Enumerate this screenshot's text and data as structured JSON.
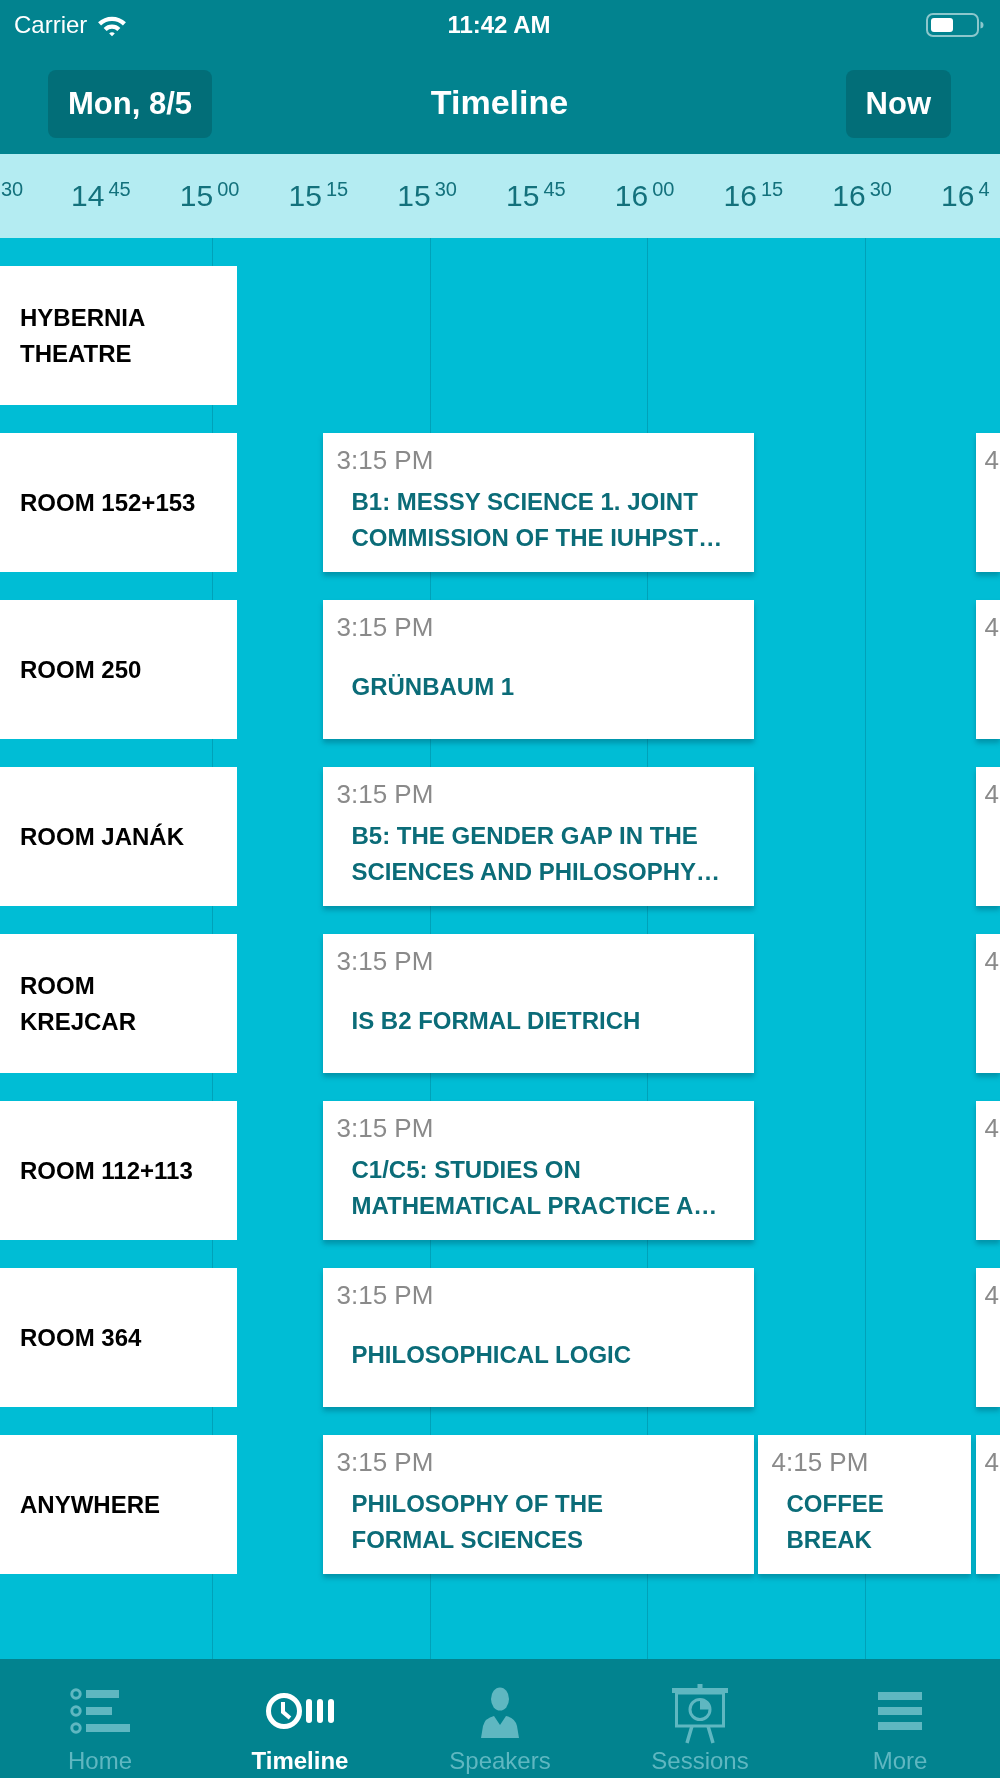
{
  "status_bar": {
    "carrier": "Carrier",
    "time": "11:42 AM"
  },
  "header": {
    "date_button": "Mon, 8/5",
    "title": "Timeline",
    "now_button": "Now"
  },
  "ruler": {
    "ticks": [
      "$^{30}$",
      "14$^{45}$",
      "15$^{00}$",
      "15$^{15}$",
      "15$^{30}$",
      "15$^{45}$",
      "16$^{00}$",
      "16$^{15}$",
      "16$^{30}$",
      "16$^{4}$"
    ]
  },
  "rooms": [
    {
      "name": "HYBERNIA\nTHEATRE"
    },
    {
      "name": "ROOM 152+153",
      "sessions": [
        {
          "kind": "talk",
          "time": "3:15 PM",
          "title": "B1: MESSY SCIENCE 1. JOINT\nCOMMISSION OF THE IUHPST…"
        },
        {
          "kind": "clipped",
          "time": "4"
        }
      ]
    },
    {
      "name": "ROOM 250",
      "sessions": [
        {
          "kind": "talk",
          "time": "3:15 PM",
          "title": "GRÜNBAUM 1"
        },
        {
          "kind": "clipped",
          "time": "4"
        }
      ]
    },
    {
      "name": "ROOM JANÁK",
      "sessions": [
        {
          "kind": "talk",
          "time": "3:15 PM",
          "title": "B5: THE GENDER GAP IN THE\nSCIENCES AND PHILOSOPHY…"
        },
        {
          "kind": "clipped",
          "time": "4"
        }
      ]
    },
    {
      "name": "ROOM\nKREJCAR",
      "sessions": [
        {
          "kind": "talk",
          "time": "3:15 PM",
          "title": "IS B2 FORMAL DIETRICH"
        },
        {
          "kind": "clipped",
          "time": "4"
        }
      ]
    },
    {
      "name": "ROOM 112+113",
      "sessions": [
        {
          "kind": "talk",
          "time": "3:15 PM",
          "title": "C1/C5: STUDIES ON\nMATHEMATICAL PRACTICE A…"
        },
        {
          "kind": "clipped",
          "time": "4"
        }
      ]
    },
    {
      "name": "ROOM 364",
      "sessions": [
        {
          "kind": "talk",
          "time": "3:15 PM",
          "title": "PHILOSOPHICAL LOGIC"
        },
        {
          "kind": "clipped",
          "time": "4"
        }
      ]
    },
    {
      "name": "ANYWHERE",
      "sessions": [
        {
          "kind": "talk",
          "time": "3:15 PM",
          "title": "PHILOSOPHY OF THE\nFORMAL SCIENCES"
        },
        {
          "kind": "break",
          "time": "4:15 PM",
          "title": "COFFEE\nBREAK"
        },
        {
          "kind": "clipped",
          "time": "4"
        }
      ]
    }
  ],
  "tab_bar": {
    "tabs": [
      {
        "label": "Home",
        "selected": false
      },
      {
        "label": "Timeline",
        "selected": true
      },
      {
        "label": "Speakers",
        "selected": false
      },
      {
        "label": "Sessions",
        "selected": false
      },
      {
        "label": "More",
        "selected": false
      }
    ]
  }
}
